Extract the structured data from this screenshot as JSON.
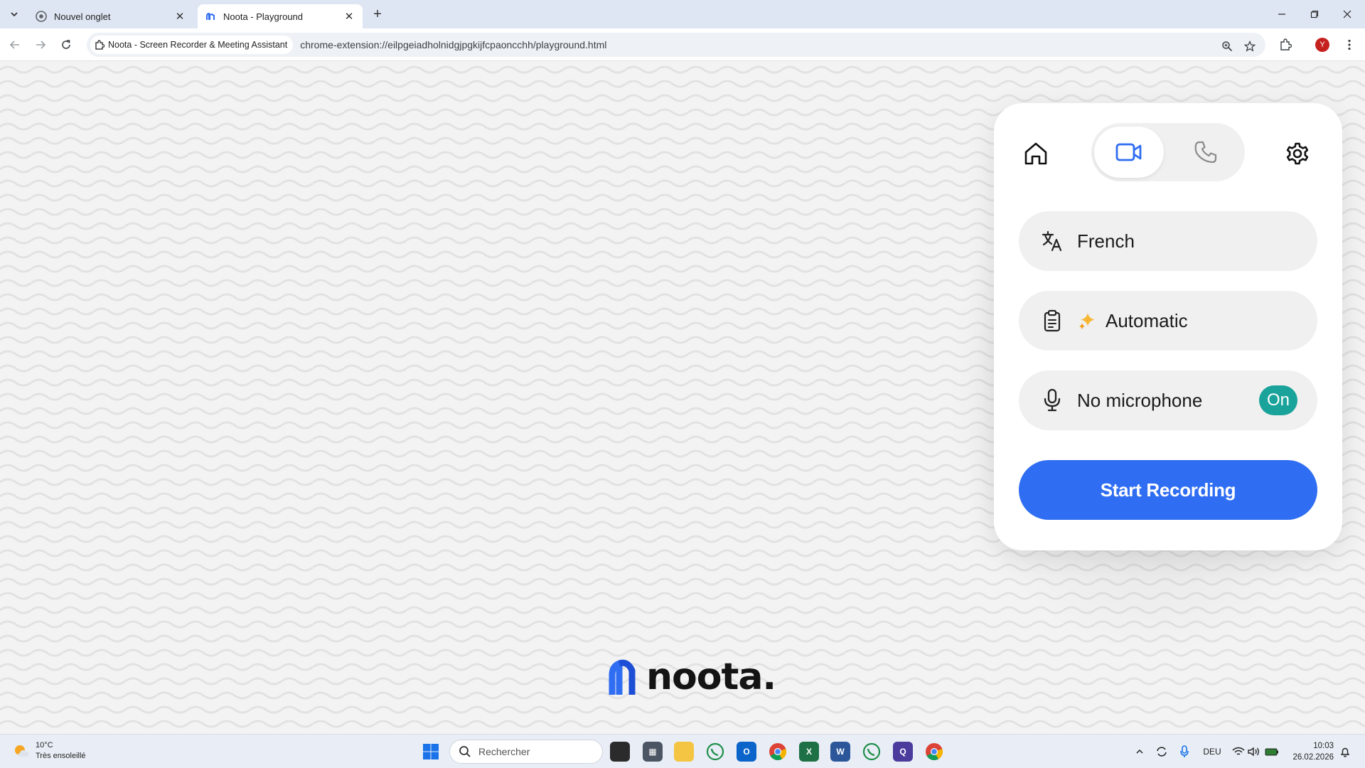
{
  "browser": {
    "tabs": [
      {
        "label": "Nouvel onglet",
        "active": false
      },
      {
        "label": "Noota - Playground",
        "active": true
      }
    ],
    "site_chip": "Noota - Screen Recorder & Meeting Assistant",
    "url": "chrome-extension://eilpgeiadholnidgjpgkijfcpaoncchh/playground.html",
    "profile_initial": "Y"
  },
  "panel": {
    "language": "French",
    "template": "Automatic",
    "microphone": "No microphone",
    "mic_toggle": "On",
    "start_button": "Start Recording",
    "active_mode": "video"
  },
  "logo": {
    "wordmark": "noota."
  },
  "taskbar": {
    "weather_temp": "10°C",
    "weather_desc": "Très ensoleillé",
    "search_placeholder": "Rechercher",
    "language": "DEU",
    "time": "10:03",
    "date": "26.02.2026"
  },
  "colors": {
    "accent_blue": "#2f6df2",
    "toggle_teal": "#1aa39a"
  }
}
